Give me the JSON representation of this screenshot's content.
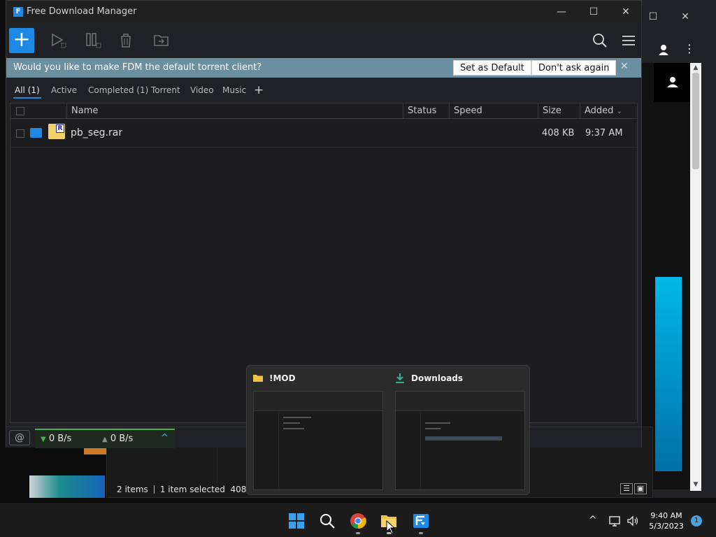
{
  "app": {
    "title": "Free Download Manager",
    "logo_letter": "F"
  },
  "window_controls": {
    "minimize": "—",
    "maximize": "☐",
    "close": "✕"
  },
  "toolbar": {
    "add_label": "+",
    "icons": [
      "play-icon",
      "pause-icon",
      "trash-icon",
      "move-folder-icon",
      "search-icon",
      "menu-icon"
    ]
  },
  "banner": {
    "message": "Would you like to make FDM the default torrent client?",
    "set_default": "Set as Default",
    "dont_ask": "Don't ask again",
    "close": "✕"
  },
  "tabs": [
    {
      "label": "All (1)",
      "active": true
    },
    {
      "label": "Active",
      "active": false
    },
    {
      "label": "Completed (1)",
      "active": false
    },
    {
      "label": "Torrent",
      "active": false
    },
    {
      "label": "Video",
      "active": false
    },
    {
      "label": "Music",
      "active": false
    }
  ],
  "tab_add": "+",
  "table": {
    "columns": [
      "Name",
      "Status",
      "Speed",
      "Size",
      "Added"
    ],
    "sort_indicator": "⌄",
    "rows": [
      {
        "name": "pb_seg.rar",
        "status": "",
        "speed": "",
        "size": "408 KB",
        "added": "9:37 AM",
        "file_badge": "R"
      }
    ]
  },
  "statusbar": {
    "download_speed": "0 B/s",
    "upload_speed": "0 B/s",
    "down_arrow": "▼",
    "up_arrow": "▲",
    "expand": "^"
  },
  "explorer_bg": {
    "items_count": "2 items",
    "selected": "1 item selected",
    "selected_size": "408 KB"
  },
  "popup": {
    "cards": [
      {
        "label": "!MOD",
        "icon": "folder-icon"
      },
      {
        "label": "Downloads",
        "icon": "download-icon"
      }
    ]
  },
  "taskbar": {
    "time": "9:40 AM",
    "date": "5/3/2023",
    "notification_count": "1",
    "tray_chevron": "^"
  },
  "colors": {
    "accent": "#1e88e5",
    "banner": "#6b8fa0",
    "speed_green": "#4caf50"
  }
}
